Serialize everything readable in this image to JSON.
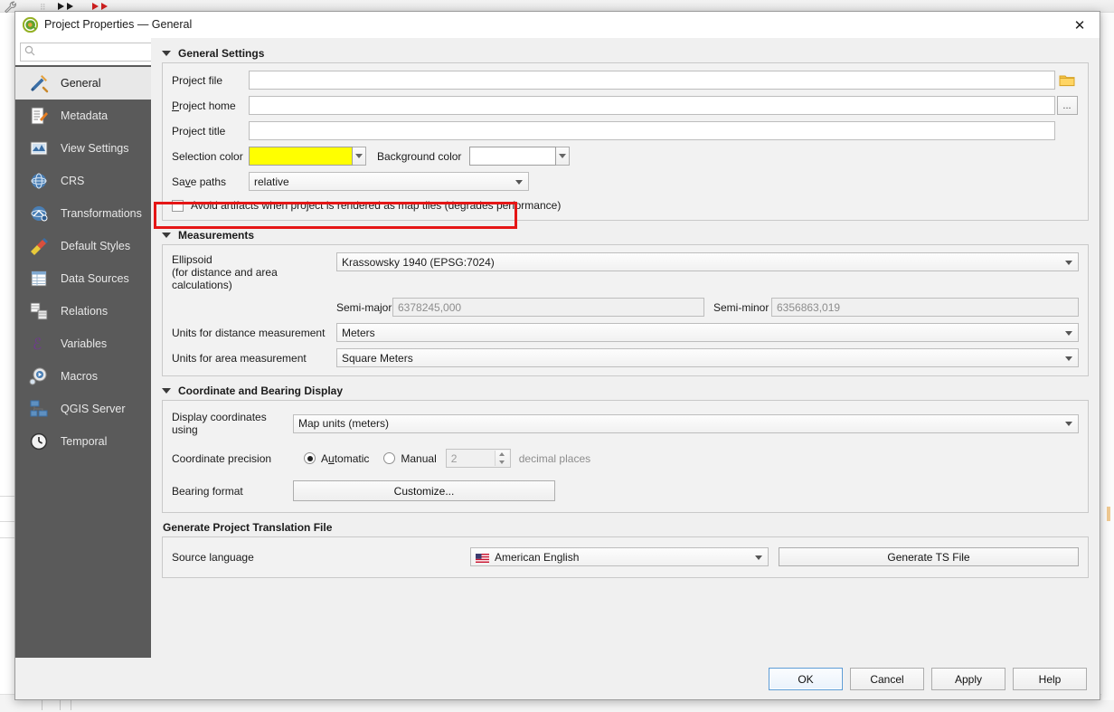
{
  "window": {
    "title": "Project Properties — General",
    "logo_icon": "qgis-logo-icon",
    "close_icon": "close-icon"
  },
  "sidebar": {
    "search": {
      "value": "",
      "placeholder": "",
      "icon": "search-icon"
    },
    "items": [
      {
        "label": "General",
        "icon": "hammer-tools-icon",
        "active": true
      },
      {
        "label": "Metadata",
        "icon": "document-pencil-icon",
        "active": false
      },
      {
        "label": "View Settings",
        "icon": "map-view-icon",
        "active": false
      },
      {
        "label": "CRS",
        "icon": "globe-icon",
        "active": false
      },
      {
        "label": "Transformations",
        "icon": "globe-transform-icon",
        "active": false
      },
      {
        "label": "Default Styles",
        "icon": "paintbrush-icon",
        "active": false
      },
      {
        "label": "Data Sources",
        "icon": "table-grid-icon",
        "active": false
      },
      {
        "label": "Relations",
        "icon": "relations-icon",
        "active": false
      },
      {
        "label": "Variables",
        "icon": "epsilon-icon",
        "active": false
      },
      {
        "label": "Macros",
        "icon": "gear-play-icon",
        "active": false
      },
      {
        "label": "QGIS Server",
        "icon": "server-network-icon",
        "active": false
      },
      {
        "label": "Temporal",
        "icon": "clock-icon",
        "active": false
      }
    ]
  },
  "general_settings": {
    "title": "General Settings",
    "project_file": {
      "label": "Project file",
      "value": "",
      "browse_icon": "folder-icon"
    },
    "project_home": {
      "label": "Project home",
      "value": "",
      "browse_label": "..."
    },
    "project_title": {
      "label": "Project title",
      "value": ""
    },
    "selection_color": {
      "label": "Selection color",
      "color": "#ffff00",
      "dropdown_icon": "chevron-down-icon"
    },
    "background_color": {
      "label": "Background color",
      "color": "#ffffff",
      "dropdown_icon": "chevron-down-icon"
    },
    "save_paths": {
      "label": "Save paths",
      "value": "relative",
      "highlighted": true
    },
    "avoid_artifacts": {
      "label": "Avoid artifacts when project is rendered as map tiles (degrades performance)",
      "checked": false
    }
  },
  "measurements": {
    "title": "Measurements",
    "ellipsoid": {
      "label_line1": "Ellipsoid",
      "label_line2": "(for distance and area calculations)",
      "value": "Krassowsky 1940 (EPSG:7024)"
    },
    "semi_major": {
      "label": "Semi-major",
      "value": "6378245,000"
    },
    "semi_minor": {
      "label": "Semi-minor",
      "value": "6356863,019"
    },
    "distance_units": {
      "label": "Units for distance measurement",
      "value": "Meters"
    },
    "area_units": {
      "label": "Units for area measurement",
      "value": "Square Meters"
    }
  },
  "coordinate_display": {
    "title": "Coordinate and Bearing Display",
    "display_coordinates": {
      "label": "Display coordinates using",
      "value": "Map units (meters)"
    },
    "coordinate_precision": {
      "label": "Coordinate precision",
      "automatic_label": "Automatic",
      "manual_label": "Manual",
      "selected": "Automatic",
      "decimals_value": "2",
      "decimals_suffix": "decimal places"
    },
    "bearing_format": {
      "label": "Bearing format",
      "button_label": "Customize..."
    }
  },
  "translation": {
    "title": "Generate Project Translation File",
    "source_language": {
      "label": "Source language",
      "value": "American English",
      "flag": "us-flag-icon"
    },
    "generate_button": "Generate TS File"
  },
  "footer": {
    "ok": "OK",
    "cancel": "Cancel",
    "apply": "Apply",
    "help": "Help"
  },
  "colors": {
    "accent": "#5b9bd5",
    "highlight_box": "#e51616",
    "selection_yellow": "#ffff00",
    "sidebar_bg": "#5a5a5a"
  }
}
